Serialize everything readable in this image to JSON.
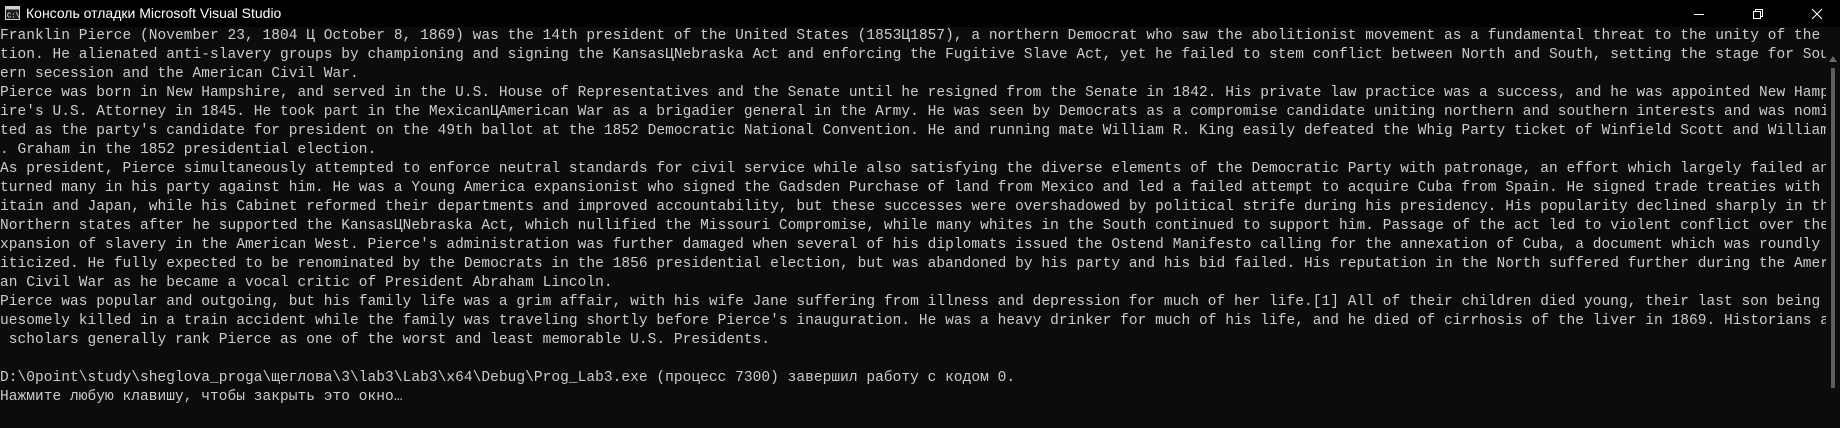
{
  "window": {
    "title": "Консоль отладки Microsoft Visual Studio",
    "icon": "console-app-icon",
    "controls": [
      "minimize-icon",
      "maximize-icon",
      "close-icon"
    ]
  },
  "console": {
    "lines": [
      "Franklin Pierce (November 23, 1804 Ц October 8, 1869) was the 14th president of the United States (1853Ц1857), a northern Democrat who saw the abolitionist movement as a fundamental threat to the unity of the na",
      "tion. He alienated anti-slavery groups by championing and signing the KansasЦNebraska Act and enforcing the Fugitive Slave Act, yet he failed to stem conflict between North and South, setting the stage for South",
      "ern secession and the American Civil War.",
      "Pierce was born in New Hampshire, and served in the U.S. House of Representatives and the Senate until he resigned from the Senate in 1842. His private law practice was a success, and he was appointed New Hampsh",
      "ire's U.S. Attorney in 1845. He took part in the MexicanЦAmerican War as a brigadier general in the Army. He was seen by Democrats as a compromise candidate uniting northern and southern interests and was nomina",
      "ted as the party's candidate for president on the 49th ballot at the 1852 Democratic National Convention. He and running mate William R. King easily defeated the Whig Party ticket of Winfield Scott and William A",
      ". Graham in the 1852 presidential election.",
      "As president, Pierce simultaneously attempted to enforce neutral standards for civil service while also satisfying the diverse elements of the Democratic Party with patronage, an effort which largely failed and",
      "turned many in his party against him. He was a Young America expansionist who signed the Gadsden Purchase of land from Mexico and led a failed attempt to acquire Cuba from Spain. He signed trade treaties with Br",
      "itain and Japan, while his Cabinet reformed their departments and improved accountability, but these successes were overshadowed by political strife during his presidency. His popularity declined sharply in the",
      "Northern states after he supported the KansasЦNebraska Act, which nullified the Missouri Compromise, while many whites in the South continued to support him. Passage of the act led to violent conflict over the e",
      "xpansion of slavery in the American West. Pierce's administration was further damaged when several of his diplomats issued the Ostend Manifesto calling for the annexation of Cuba, a document which was roundly cr",
      "iticized. He fully expected to be renominated by the Democrats in the 1856 presidential election, but was abandoned by his party and his bid failed. His reputation in the North suffered further during the Americ",
      "an Civil War as he became a vocal critic of President Abraham Lincoln.",
      "Pierce was popular and outgoing, but his family life was a grim affair, with his wife Jane suffering from illness and depression for much of her life.[1] All of their children died young, their last son being gr",
      "uesomely killed in a train accident while the family was traveling shortly before Pierce's inauguration. He was a heavy drinker for much of his life, and he died of cirrhosis of the liver in 1869. Historians and",
      " scholars generally rank Pierce as one of the worst and least memorable U.S. Presidents.",
      "",
      "D:\\0point\\study\\sheglova_proga\\щеглова\\3\\lab3\\Lab3\\x64\\Debug\\Prog_Lab3.exe (процесс 7300) завершил работу с кодом 0.",
      "Нажмите любую клавишу, чтобы закрыть это окно…"
    ]
  },
  "colors": {
    "background": "#0c0c0c",
    "titlebar": "#000000",
    "text": "#cccccc",
    "scroll_thumb": "#5d5d5d"
  }
}
